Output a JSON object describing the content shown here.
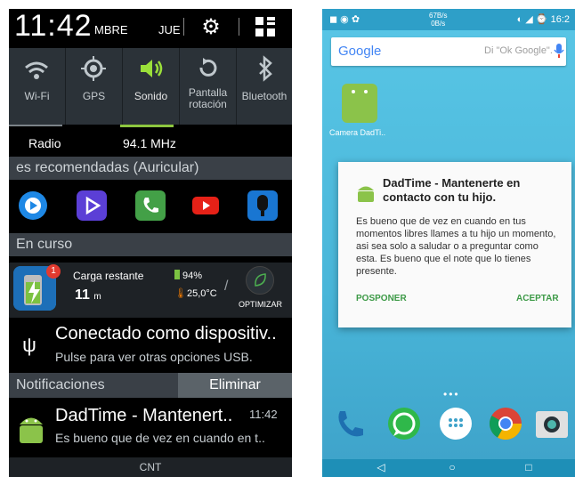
{
  "left": {
    "status": {
      "time": "11:42",
      "month": "MBRE",
      "day": "JUE"
    },
    "quick_settings": [
      {
        "label": "Wi-Fi",
        "icon": "wifi-icon",
        "active": false
      },
      {
        "label": "GPS",
        "icon": "gps-icon",
        "active": false
      },
      {
        "label": "Sonido",
        "icon": "sound-icon",
        "active": true
      },
      {
        "label": "Pantalla rotación",
        "icon": "rotation-icon",
        "active": false
      },
      {
        "label": "Bluetooth",
        "icon": "bluetooth-icon",
        "active": false
      }
    ],
    "radio": {
      "label": "Radio",
      "freq": "94.1 MHz"
    },
    "apps_section": {
      "title": "es recomendadas (Auricular)"
    },
    "ongoing_section": {
      "title": "En curso"
    },
    "battery": {
      "label": "Carga restante",
      "time_value": "11",
      "time_unit": "m",
      "badge": "1",
      "percent": "94%",
      "temp": "25,0°C",
      "optimize": "OPTIMIZAR"
    },
    "usb": {
      "title": "Conectado como dispositiv..",
      "subtitle": "Pulse para ver otras opciones USB."
    },
    "notifications": {
      "title": "Notificaciones",
      "clear": "Eliminar"
    },
    "dad": {
      "title": "DadTime - Mantenert..",
      "time": "11:42",
      "subtitle": "Es bueno que de vez en cuando en t.."
    },
    "carrier": "CNT"
  },
  "right": {
    "status": {
      "speed": "67B/s\n0B/s",
      "time": "16:2"
    },
    "search": {
      "logo": "Google",
      "hint": "Di \"Ok Google\"."
    },
    "app_label": "Camera DadTi..",
    "dialog": {
      "title": "DadTime - Mantenerte en contacto con tu hijo.",
      "body": "Es bueno que de vez en cuando en tus momentos libres llames a tu hijo un momento, asi sea solo a saludar o a preguntar como esta. Es bueno que el note que lo tienes presente.",
      "postpone": "POSPONER",
      "accept": "ACEPTAR"
    },
    "page_dots": "•••"
  },
  "colors": {
    "accent_green": "#8dc63f",
    "dialog_button": "#3d9a47",
    "wallpaper": "#49b6d9"
  }
}
